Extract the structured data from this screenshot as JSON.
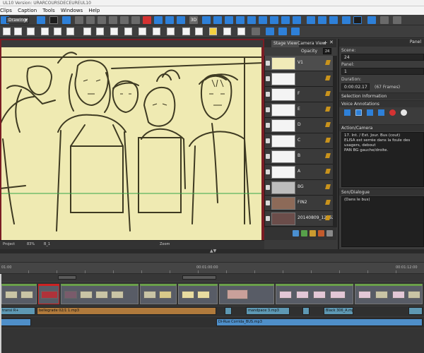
{
  "window": {
    "title": "UL10 Version: URARCOURSDECEUREUL10"
  },
  "menu": [
    "Clips",
    "Caption",
    "Tools",
    "Windows",
    "Help"
  ],
  "toolbar": {
    "mode_value": "Drawing"
  },
  "stage_tabs": {
    "stage": "Stage View",
    "camera": "Camera View"
  },
  "opacity": {
    "label": "Opacity",
    "value": "24"
  },
  "layers": [
    {
      "name": "V1"
    },
    {
      "name": ""
    },
    {
      "name": "F"
    },
    {
      "name": "E"
    },
    {
      "name": "D"
    },
    {
      "name": "C"
    },
    {
      "name": "B"
    },
    {
      "name": "A"
    },
    {
      "name": "BG"
    },
    {
      "name": "FIN2"
    },
    {
      "name": "20140809_12562"
    }
  ],
  "canvas_status": {
    "left": "Project",
    "zoom": "83%",
    "field": "B_1",
    "mode": "Zoom"
  },
  "inspector": {
    "tab": "Panel",
    "scene_label": "Scene:",
    "scene_value": "24",
    "panel_label": "Panel:",
    "panel_value": "1",
    "duration_label": "Duration:",
    "duration_value": "0:00:02.17",
    "duration_frames": "(67 Frames)",
    "selection_section": "Selection Information",
    "voice_section": "Voice Annotations",
    "action_section": "Action/Camera",
    "action_text_line1": "17.            Int. / Ext. Jour. Bus (cout)",
    "action_text_line2": "ELISA est serrée dans la foule des usagers, debout",
    "action_text_line3": "PAN BG gauche/droite.",
    "dialogue_section": "Son/Dialogue",
    "dialogue_text": "(Dans le bus)"
  },
  "timeline": {
    "timecodes": [
      "01:00",
      "00:01:00:00",
      "00:01:12:00"
    ],
    "audio1_clips": [
      {
        "label": "transi R+",
        "color": "teal"
      },
      {
        "label": "bellegrade 02/1 1.mp3",
        "color": "orange"
      },
      {
        "label": "",
        "color": "teal"
      },
      {
        "label": "mandpace 3.mp3",
        "color": "teal"
      },
      {
        "label": "",
        "color": "teal"
      },
      {
        "label": "Black 306_A.mp3",
        "color": "teal"
      },
      {
        "label": "",
        "color": "teal"
      }
    ],
    "audio2_clips": [
      {
        "label": "",
        "color": "blue"
      },
      {
        "label": "Di-Rue Corrida_BUS.mp3",
        "color": "blue"
      }
    ]
  },
  "colors": {
    "canvas_bg": "#efeab2",
    "frame_red": "#7a1d24",
    "clip_green": "#6aa04a",
    "audio_blue": "#4f8fc9",
    "accent_blue": "#2e80d8"
  }
}
